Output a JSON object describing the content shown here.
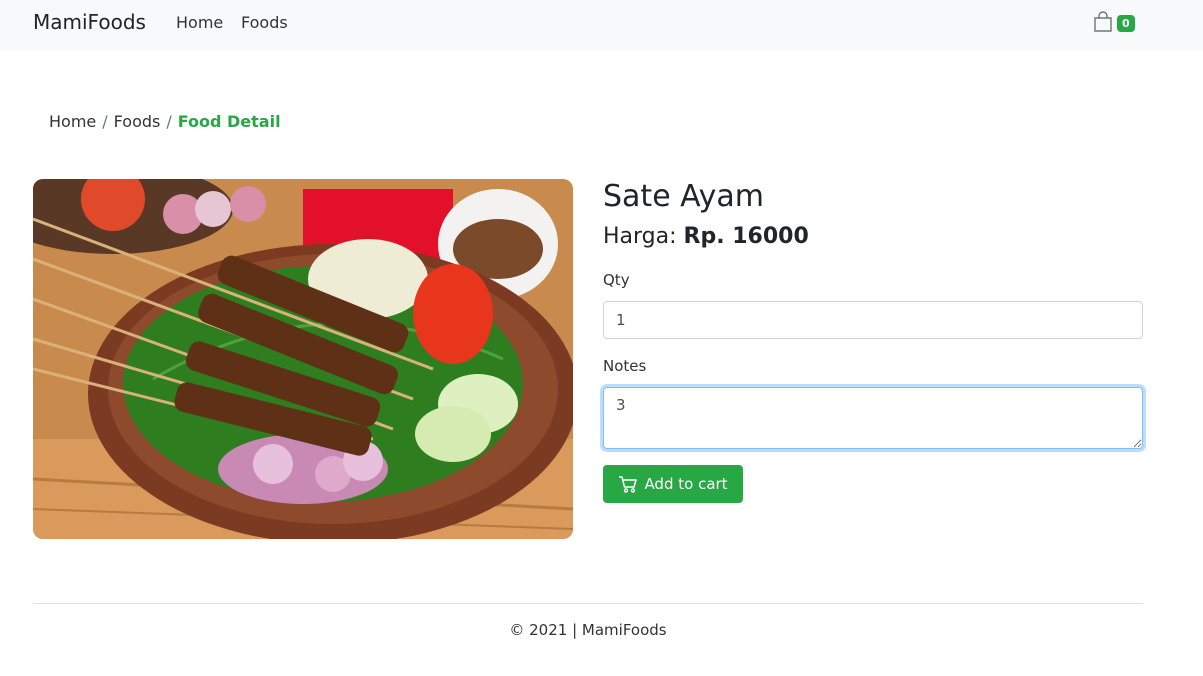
{
  "navbar": {
    "brand": "MamiFoods",
    "links": [
      "Home",
      "Foods"
    ],
    "cart_count": "0"
  },
  "breadcrumb": {
    "items": [
      "Home",
      "Foods"
    ],
    "active": "Food Detail"
  },
  "food": {
    "name": "Sate Ayam",
    "price_label": "Harga:",
    "price_value": "Rp. 16000",
    "image_alt": "Sate Ayam"
  },
  "form": {
    "qty_label": "Qty",
    "qty_value": "1",
    "notes_label": "Notes",
    "notes_value": "3",
    "add_button": "Add to cart"
  },
  "footer": {
    "text": "© 2021 | MamiFoods"
  },
  "colors": {
    "accent": "#28a745",
    "navbar_bg": "#f8f9fa",
    "focus_border": "#80bdff"
  },
  "icons": [
    "bag-icon",
    "cart-icon"
  ]
}
